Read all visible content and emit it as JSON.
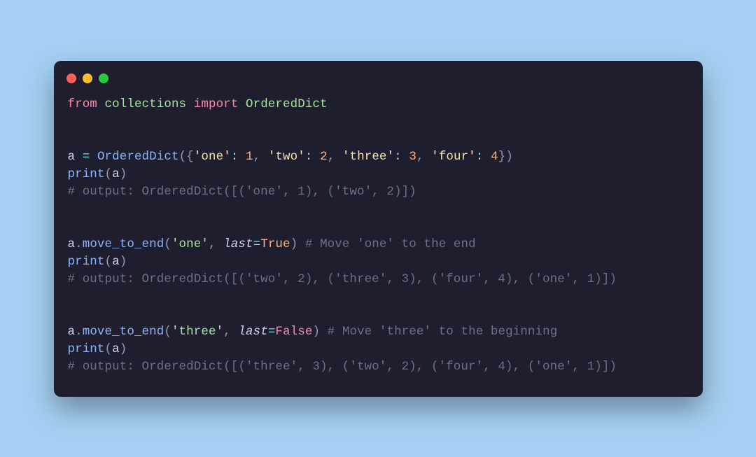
{
  "window": {
    "traffic_lights": [
      "red",
      "yellow",
      "green"
    ]
  },
  "code": {
    "l1": {
      "from": "from",
      "mod": "collections",
      "import": "import",
      "cls": "OrderedDict"
    },
    "l4": {
      "var": "a",
      "eq": "=",
      "call": "OrderedDict",
      "op": "({",
      "k1": "'one'",
      "c1": ":",
      "v1": "1",
      "s1": ",",
      "k2": "'two'",
      "c2": ":",
      "v2": "2",
      "s2": ",",
      "k3": "'three'",
      "c3": ":",
      "v3": "3",
      "s3": ",",
      "k4": "'four'",
      "c4": ":",
      "v4": "4",
      "cl": "})"
    },
    "l5": {
      "fn": "print",
      "op": "(",
      "arg": "a",
      "cl": ")"
    },
    "l6": {
      "text": "# output: OrderedDict([('one', 1), ('two', 2)])"
    },
    "l9": {
      "var": "a",
      "dot": ".",
      "fn": "move_to_end",
      "op": "(",
      "arg1": "'one'",
      "sep": ",",
      "kw": "last",
      "eq": "=",
      "val": "True",
      "cl": ")",
      "cmt": "# Move 'one' to the end"
    },
    "l10": {
      "fn": "print",
      "op": "(",
      "arg": "a",
      "cl": ")"
    },
    "l11": {
      "text": "# output: OrderedDict([('two', 2), ('three', 3), ('four', 4), ('one', 1)])"
    },
    "l14": {
      "var": "a",
      "dot": ".",
      "fn": "move_to_end",
      "op": "(",
      "arg1": "'three'",
      "sep": ",",
      "kw": "last",
      "eq": "=",
      "val": "False",
      "cl": ")",
      "cmt": "# Move 'three' to the beginning"
    },
    "l15": {
      "fn": "print",
      "op": "(",
      "arg": "a",
      "cl": ")"
    },
    "l16": {
      "text": "# output: OrderedDict([('three', 3), ('two', 2), ('four', 4), ('one', 1)])"
    }
  }
}
